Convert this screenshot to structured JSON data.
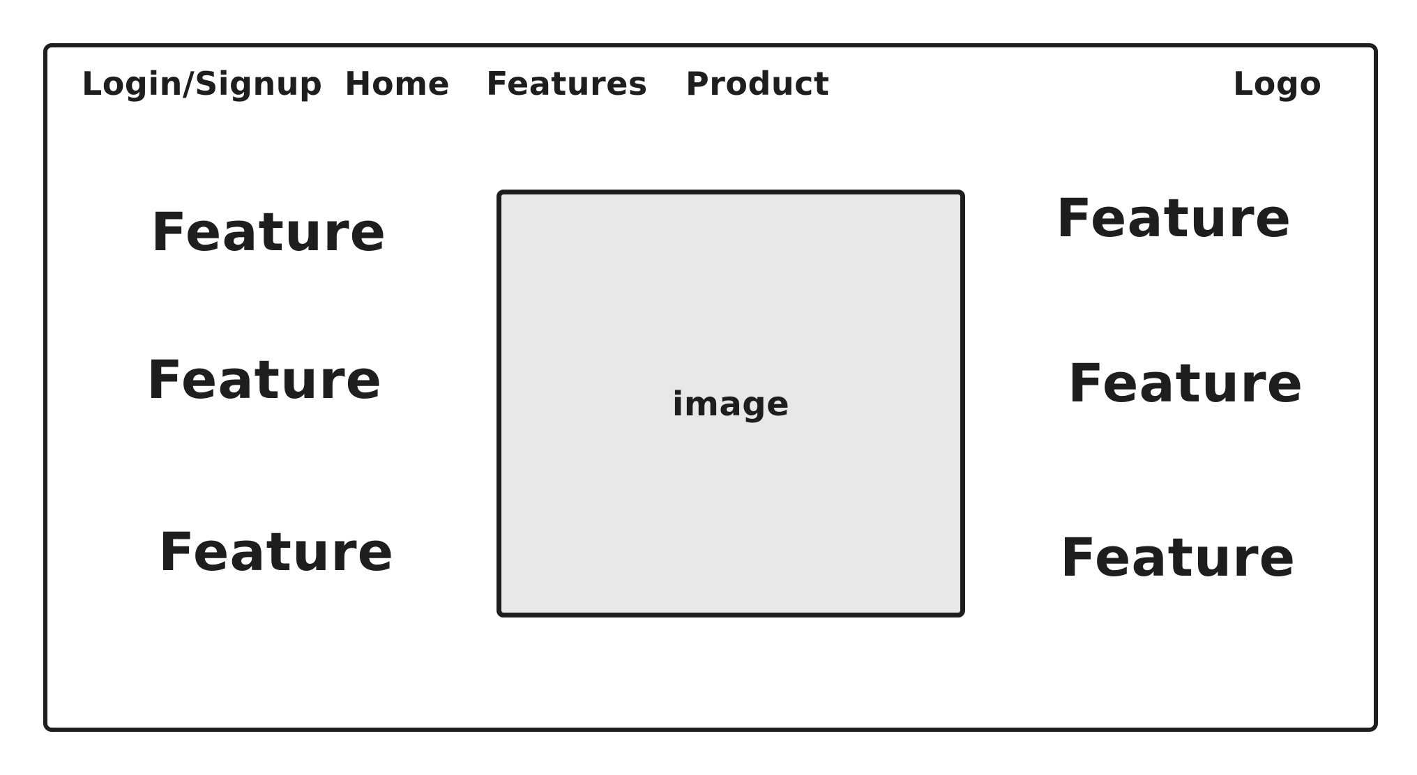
{
  "nav": {
    "login": "Login/Signup",
    "home": "Home",
    "features": "Features",
    "product": "Product",
    "logo": "Logo"
  },
  "features_left": [
    "Feature",
    "Feature",
    "Feature"
  ],
  "features_right": [
    "Feature",
    "Feature",
    "Feature"
  ],
  "image_placeholder": {
    "label": "image",
    "fill_color": "#e8e8e8"
  },
  "colors": {
    "stroke": "#1e1e1e",
    "background": "#ffffff"
  }
}
